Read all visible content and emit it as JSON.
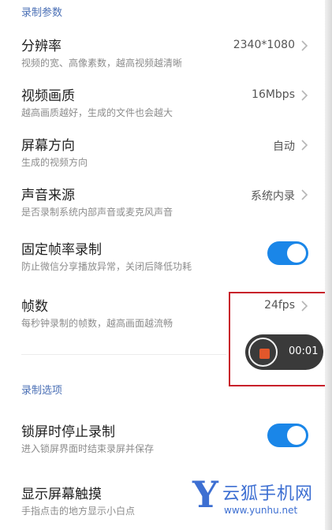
{
  "sections": {
    "recording_params": "录制参数",
    "recording_options": "录制选项"
  },
  "settings": [
    {
      "title": "分辨率",
      "subtitle": "视频的宽、高像素数，越高视频越清晰",
      "value": "2340*1080",
      "control": "chevron"
    },
    {
      "title": "视频画质",
      "subtitle": "越高画质越好，生成的文件也会越大",
      "value": "16Mbps",
      "control": "chevron"
    },
    {
      "title": "屏幕方向",
      "subtitle": "生成的视频方向",
      "value": "自动",
      "control": "chevron"
    },
    {
      "title": "声音来源",
      "subtitle": "是否录制系统内部声音或麦克风声音",
      "value": "系统内录",
      "control": "chevron"
    },
    {
      "title": "固定帧率录制",
      "subtitle": "防止微信分享播放异常，关闭后降低功耗",
      "control": "toggle",
      "toggle_on": true
    },
    {
      "title": "帧数",
      "subtitle": "每秒钟录制的帧数，越高画面越流畅",
      "value": "24fps",
      "control": "chevron"
    }
  ],
  "options": [
    {
      "title": "锁屏时停止录制",
      "subtitle": "进入锁屏界面时结束录屏并保存",
      "control": "toggle",
      "toggle_on": true
    },
    {
      "title": "显示屏幕触摸",
      "subtitle": "手指点击的地方显示小白点"
    }
  ],
  "recorder": {
    "elapsed": "00:01",
    "stop_icon": "stop-icon"
  },
  "watermark": {
    "logo_letter": "Y",
    "name": "云狐手机网",
    "url": "www.yunhu.net"
  },
  "colors": {
    "accent": "#1a86e8",
    "section_header": "#4a6fb5",
    "highlight_border": "#c8202a",
    "record_stop": "#e2572b",
    "watermark": "#3d6fd2"
  }
}
